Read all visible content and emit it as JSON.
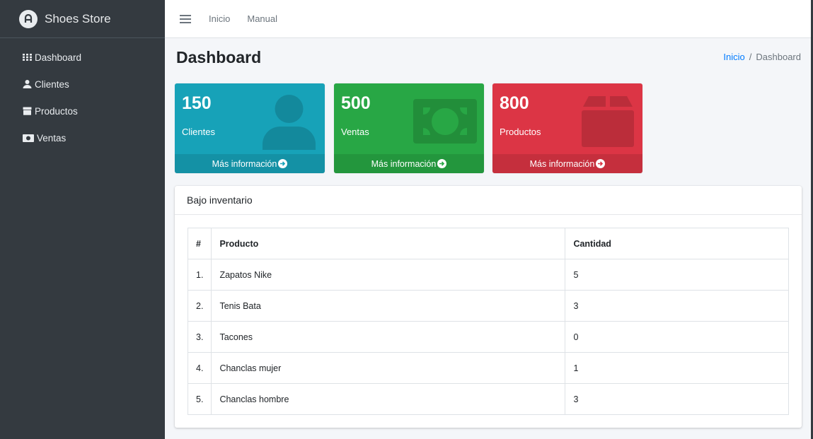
{
  "brand": {
    "name": "Shoes Store",
    "logo_icon": "app-logo-icon"
  },
  "sidebar": {
    "items": [
      {
        "label": "Dashboard",
        "icon": "grid-icon"
      },
      {
        "label": "Clientes",
        "icon": "user-icon"
      },
      {
        "label": "Productos",
        "icon": "box-icon"
      },
      {
        "label": "Ventas",
        "icon": "money-icon"
      }
    ]
  },
  "topbar": {
    "links": [
      "Inicio",
      "Manual"
    ]
  },
  "page": {
    "title": "Dashboard",
    "breadcrumb": {
      "home": "Inicio",
      "separator": "/",
      "current": "Dashboard"
    }
  },
  "boxes": [
    {
      "value": "150",
      "label": "Clientes",
      "footer": "Más información",
      "color": "#17a2b8",
      "icon": "user-icon"
    },
    {
      "value": "500",
      "label": "Ventas",
      "footer": "Más información",
      "color": "#28a745",
      "icon": "money-icon"
    },
    {
      "value": "800",
      "label": "Productos",
      "footer": "Más información",
      "color": "#dc3545",
      "icon": "box-icon"
    }
  ],
  "inventory": {
    "title": "Bajo inventario",
    "headers": [
      "#",
      "Producto",
      "Cantidad"
    ],
    "rows": [
      {
        "n": "1.",
        "producto": "Zapatos Nike",
        "cantidad": "5"
      },
      {
        "n": "2.",
        "producto": "Tenis Bata",
        "cantidad": "3"
      },
      {
        "n": "3.",
        "producto": "Tacones",
        "cantidad": "0"
      },
      {
        "n": "4.",
        "producto": "Chanclas mujer",
        "cantidad": "1"
      },
      {
        "n": "5.",
        "producto": "Chanclas hombre",
        "cantidad": "3"
      }
    ]
  }
}
